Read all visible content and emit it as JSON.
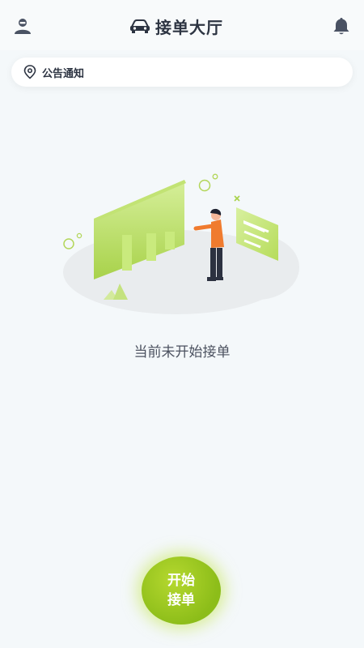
{
  "header": {
    "title": "接单大厅",
    "left_icon": "user-profile-icon",
    "right_icon": "bell-icon",
    "title_icon": "car-icon"
  },
  "notice": {
    "icon": "location-pin-icon",
    "label": "公告通知"
  },
  "empty_state": {
    "illustration": "empty-orders-illustration",
    "message": "当前未开始接单"
  },
  "action": {
    "label": "开始接单"
  },
  "colors": {
    "accent": "#a3cd27",
    "background": "#f4f8fa",
    "text_dark": "#2d3442",
    "icon_gray": "#4a5263"
  }
}
